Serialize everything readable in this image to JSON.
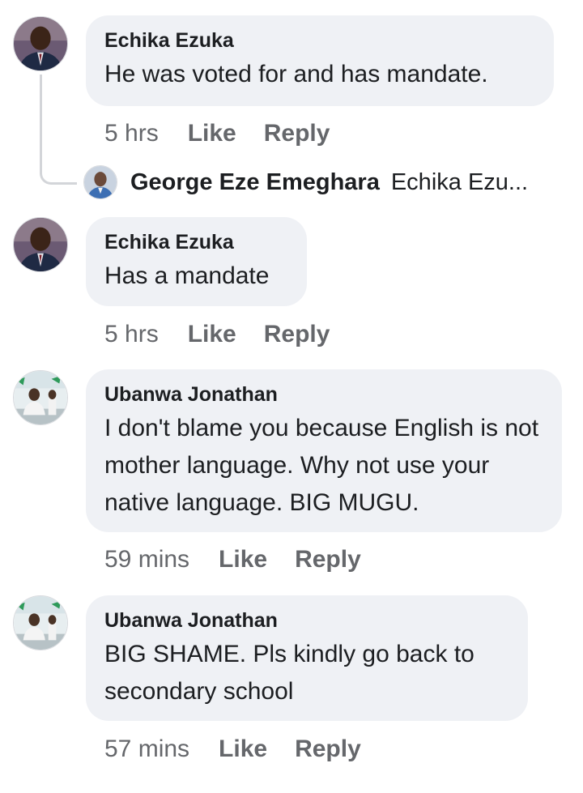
{
  "comments": [
    {
      "author": "Echika Ezuka",
      "text": "He was voted for and has mandate.",
      "time": "5 hrs",
      "like_label": "Like",
      "reply_label": "Reply",
      "avatar_icon": "man-in-suit-avatar"
    },
    {
      "author": "Echika Ezuka",
      "text": "Has a mandate",
      "time": "5 hrs",
      "like_label": "Like",
      "reply_label": "Reply",
      "avatar_icon": "man-in-suit-avatar"
    },
    {
      "author": "Ubanwa Jonathan",
      "text": "I don't blame you because English is not mother language. Why not use your native language. BIG MUGU.",
      "time": "59 mins",
      "like_label": "Like",
      "reply_label": "Reply",
      "avatar_icon": "person-outdoors-avatar"
    },
    {
      "author": "Ubanwa Jonathan",
      "text": "BIG SHAME. Pls kindly go back to secondary school",
      "time": "57 mins",
      "like_label": "Like",
      "reply_label": "Reply",
      "avatar_icon": "person-outdoors-avatar"
    }
  ],
  "reply_summary": {
    "name": "George Eze Emeghara",
    "snippet": "Echika Ezu...",
    "avatar_icon": "man-avatar"
  },
  "colors": {
    "bubble_bg": "#eff1f5",
    "meta_text": "#65676b",
    "primary_text": "#1c1e21",
    "thread_line": "#d3d5d9"
  }
}
